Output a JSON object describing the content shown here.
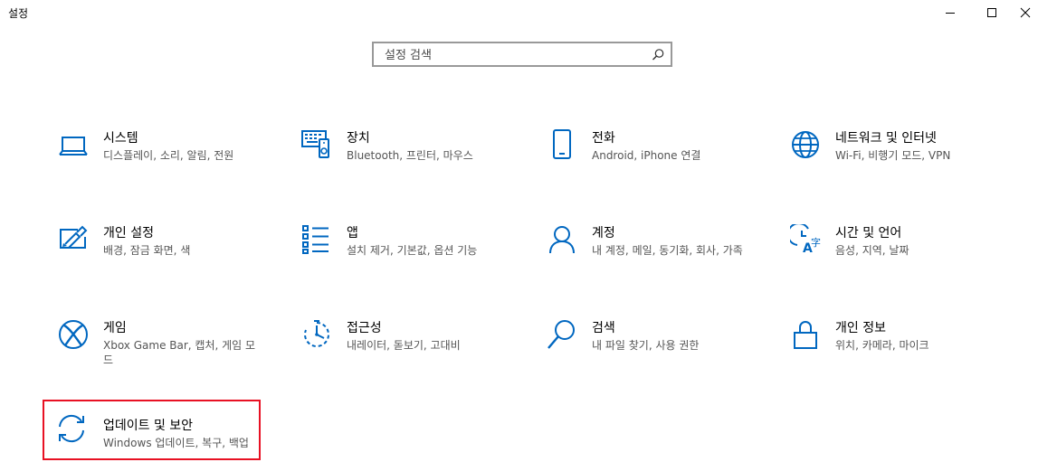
{
  "window": {
    "title": "설정",
    "minimize_glyph": "—",
    "maximize_glyph": "☐",
    "close_glyph": "✕"
  },
  "search": {
    "placeholder": "설정 검색"
  },
  "tiles": [
    {
      "title": "시스템",
      "desc": "디스플레이, 소리, 알림, 전원",
      "icon": "laptop-icon"
    },
    {
      "title": "장치",
      "desc": "Bluetooth, 프린터, 마우스",
      "icon": "devices-icon"
    },
    {
      "title": "전화",
      "desc": "Android, iPhone 연결",
      "icon": "phone-icon"
    },
    {
      "title": "네트워크 및 인터넷",
      "desc": "Wi-Fi, 비행기 모드, VPN",
      "icon": "globe-icon"
    },
    {
      "title": "개인 설정",
      "desc": "배경, 잠금 화면, 색",
      "icon": "personalization-icon"
    },
    {
      "title": "앱",
      "desc": "설치 제거, 기본값, 옵션 기능",
      "icon": "apps-list-icon"
    },
    {
      "title": "계정",
      "desc": "내 계정, 메일, 동기화, 회사, 가족",
      "icon": "person-icon"
    },
    {
      "title": "시간 및 언어",
      "desc": "음성, 지역, 날짜",
      "icon": "time-language-icon"
    },
    {
      "title": "게임",
      "desc": "Xbox Game Bar, 캡처, 게임 모드",
      "icon": "xbox-icon"
    },
    {
      "title": "접근성",
      "desc": "내레이터, 돋보기, 고대비",
      "icon": "accessibility-timer-icon"
    },
    {
      "title": "검색",
      "desc": "내 파일 찾기, 사용 권한",
      "icon": "magnifier-icon"
    },
    {
      "title": "개인 정보",
      "desc": "위치, 카메라, 마이크",
      "icon": "lock-icon"
    },
    {
      "title": "업데이트 및 보안",
      "desc": "Windows 업데이트, 복구, 백업",
      "icon": "sync-icon"
    }
  ],
  "colors": {
    "accent": "#0067c0",
    "highlight_border": "#e81123",
    "search_border": "#999999"
  }
}
